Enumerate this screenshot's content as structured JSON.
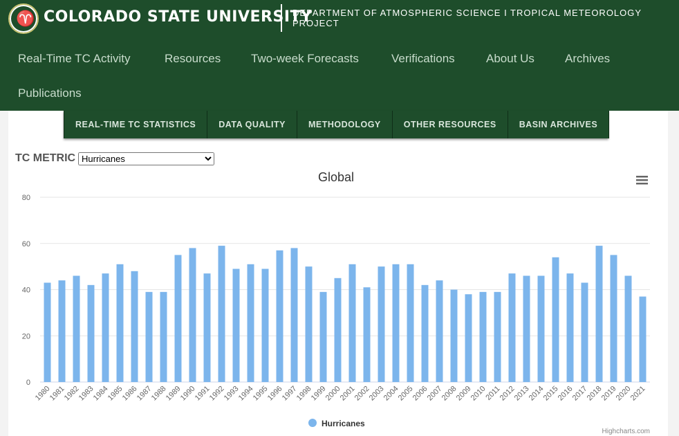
{
  "header": {
    "university": "COLORADO STATE UNIVERSITY",
    "department": "DEPARTMENT OF ATMOSPHERIC SCIENCE I TROPICAL METEOROLOGY PROJECT"
  },
  "nav": [
    "Real-Time TC Activity",
    "Resources",
    "Two-week Forecasts",
    "Verifications",
    "About Us",
    "Archives",
    "Publications"
  ],
  "subnav": [
    "REAL-TIME TC STATISTICS",
    "DATA QUALITY",
    "METHODOLOGY",
    "OTHER RESOURCES",
    "BASIN ARCHIVES"
  ],
  "metric": {
    "label": "TC METRIC",
    "selected": "Hurricanes"
  },
  "credit": "Highcharts.com",
  "chart_data": {
    "type": "bar",
    "title": "Global",
    "xlabel": "",
    "ylabel": "",
    "ylim": [
      0,
      80
    ],
    "yticks": [
      0,
      20,
      40,
      60,
      80
    ],
    "grid": true,
    "legend": "bottom-center",
    "color": "#7cb5ec",
    "categories": [
      "1980",
      "1981",
      "1982",
      "1983",
      "1984",
      "1985",
      "1986",
      "1987",
      "1988",
      "1989",
      "1990",
      "1991",
      "1992",
      "1993",
      "1994",
      "1995",
      "1996",
      "1997",
      "1998",
      "1999",
      "2000",
      "2001",
      "2002",
      "2003",
      "2004",
      "2005",
      "2006",
      "2007",
      "2008",
      "2009",
      "2010",
      "2011",
      "2012",
      "2013",
      "2014",
      "2015",
      "2016",
      "2017",
      "2018",
      "2019",
      "2020",
      "2021"
    ],
    "series": [
      {
        "name": "Hurricanes",
        "values": [
          43,
          44,
          46,
          42,
          47,
          51,
          48,
          39,
          39,
          55,
          58,
          47,
          59,
          49,
          51,
          49,
          57,
          58,
          50,
          39,
          45,
          51,
          41,
          50,
          51,
          51,
          42,
          44,
          40,
          38,
          39,
          39,
          47,
          46,
          46,
          54,
          47,
          43,
          59,
          55,
          46,
          37
        ]
      }
    ]
  }
}
